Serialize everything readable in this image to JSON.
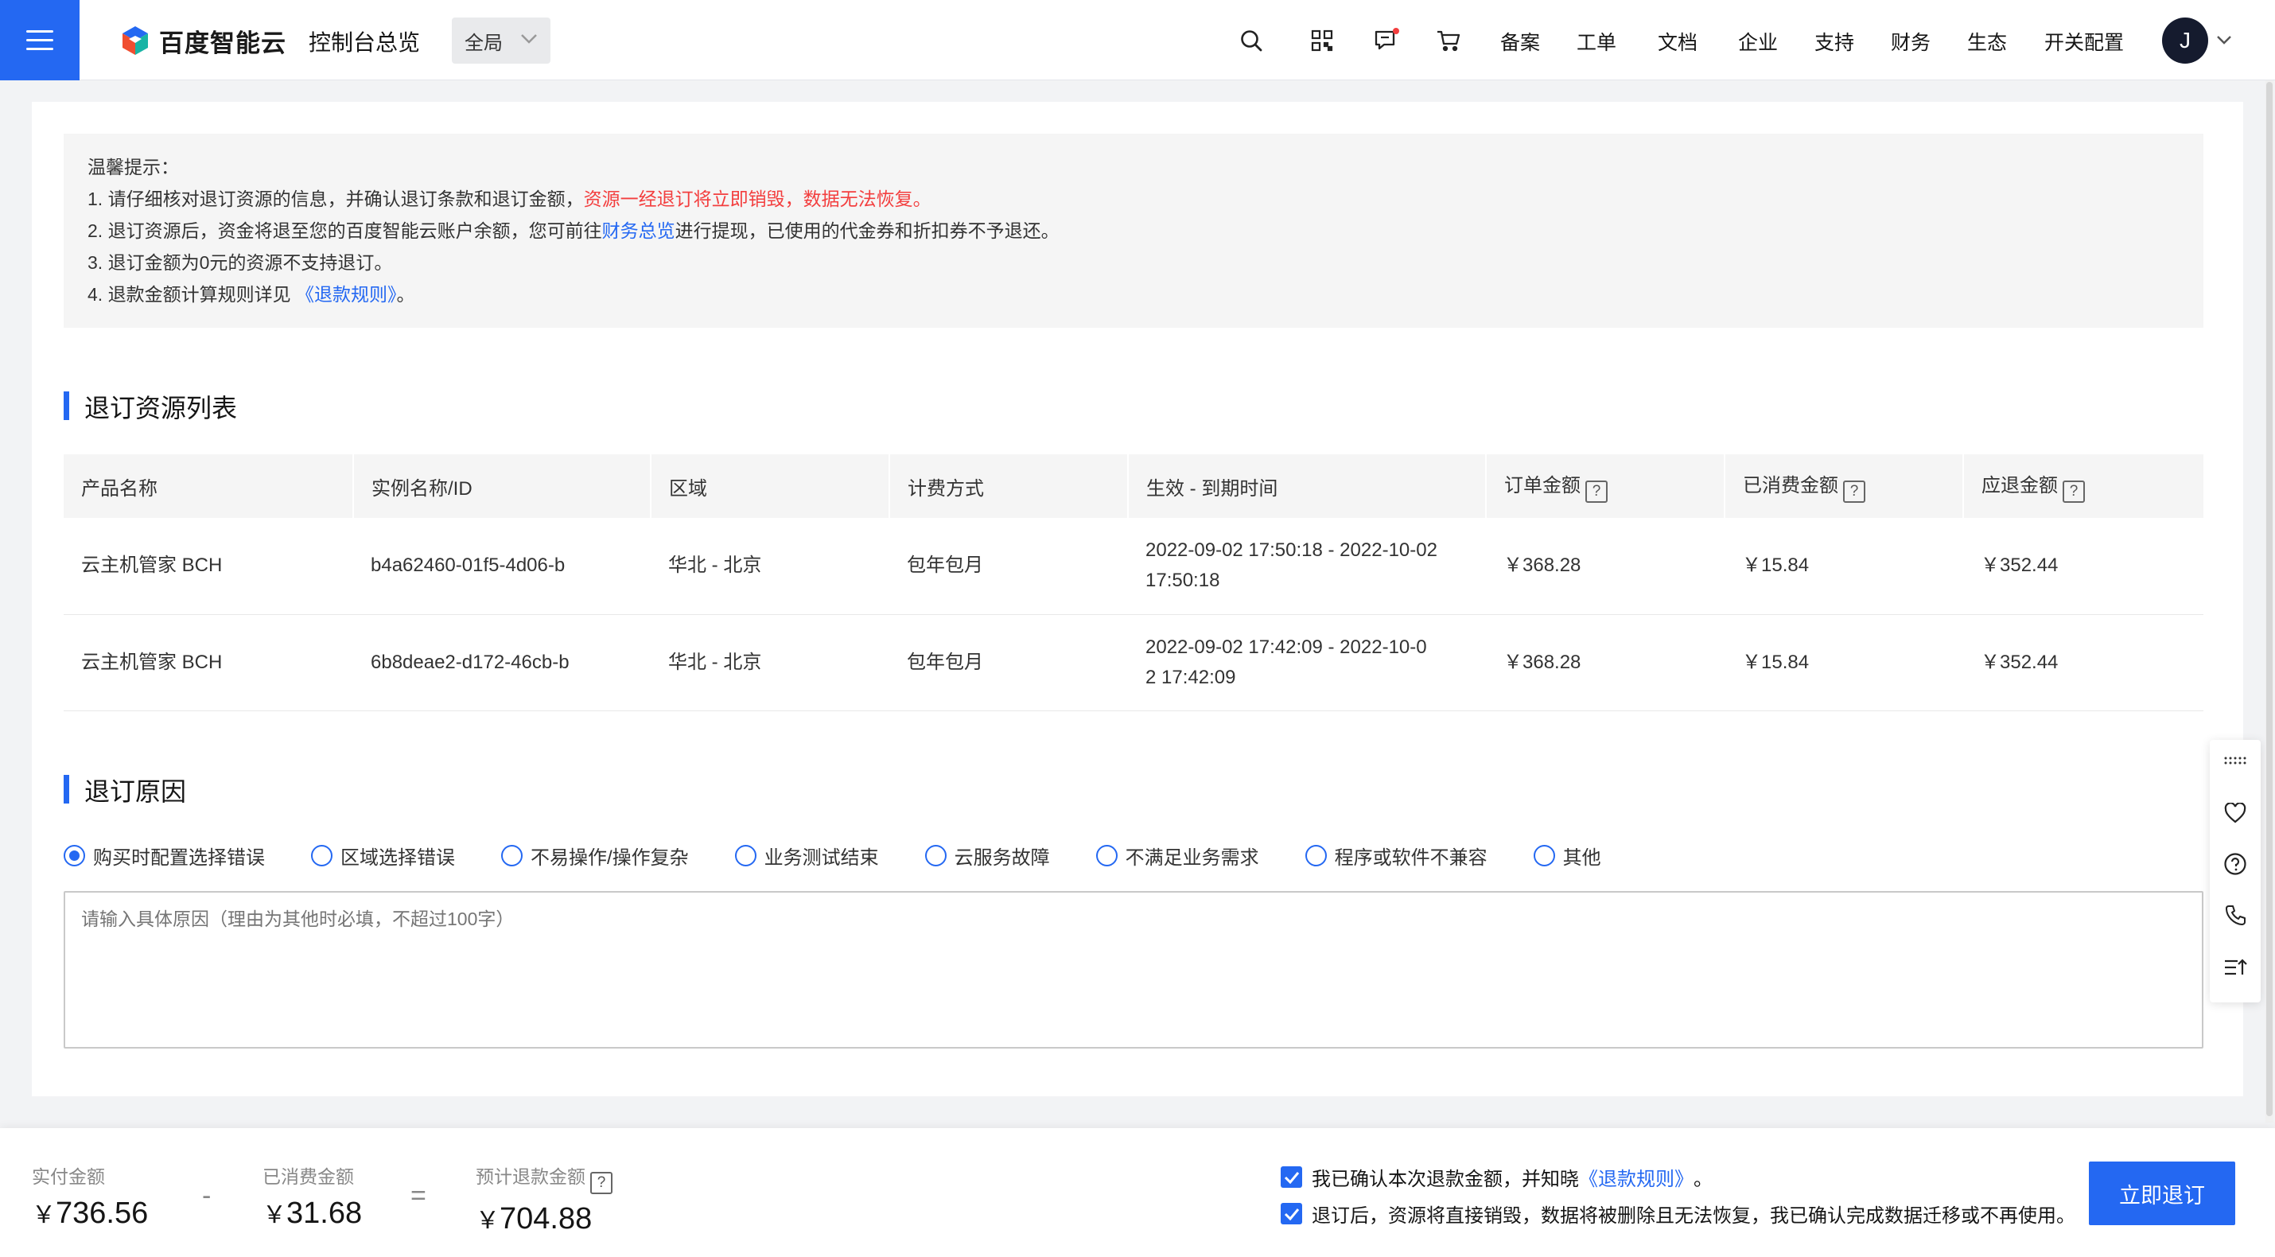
{
  "header": {
    "logo_text": "百度智能云",
    "console_title": "控制台总览",
    "region_value": "全局",
    "nav_links": [
      "备案",
      "工单",
      "文档",
      "企业",
      "支持",
      "财务",
      "生态",
      "开关配置"
    ],
    "avatar_letter": "J",
    "icons": [
      "search-icon",
      "qrcode-icon",
      "message-icon",
      "cart-icon"
    ]
  },
  "notice": {
    "title": "温馨提示：",
    "line1_prefix": "1. 请仔细核对退订资源的信息，并确认退订条款和退订金额，",
    "line1_warning": "资源一经退订将立即销毁，数据无法恢复。",
    "line2_prefix": "2. 退订资源后，资金将退至您的百度智能云账户余额，您可前往",
    "line2_link": "财务总览",
    "line2_suffix": "进行提现，已使用的代金券和折扣券不予退还。",
    "line3": "3. 退订金额为0元的资源不支持退订。",
    "line4_prefix": "4. 退款金额计算规则详见 ",
    "line4_link": "《退款规则》",
    "line4_suffix": "。"
  },
  "resource_section": {
    "title": "退订资源列表",
    "columns": [
      "产品名称",
      "实例名称/ID",
      "区域",
      "计费方式",
      "生效 - 到期时间",
      "订单金额",
      "已消费金额",
      "应退金额"
    ],
    "rows": [
      {
        "product": "云主机管家 BCH",
        "instance": "b4a62460-01f5-4d06-b",
        "region": "华北 - 北京",
        "billing": "包年包月",
        "period_line1": "2022-09-02 17:50:18 - 2022-10-02",
        "period_line2": "17:50:18",
        "order_amount": "￥368.28",
        "consumed": "￥15.84",
        "refund": "￥352.44"
      },
      {
        "product": "云主机管家 BCH",
        "instance": "6b8deae2-d172-46cb-b",
        "region": "华北 - 北京",
        "billing": "包年包月",
        "period_line1": "2022-09-02 17:42:09 - 2022-10-0",
        "period_line2": "2 17:42:09",
        "order_amount": "￥368.28",
        "consumed": "￥15.84",
        "refund": "￥352.44"
      }
    ],
    "help_mark": "?"
  },
  "reason_section": {
    "title": "退订原因",
    "options": [
      "购买时配置选择错误",
      "区域选择错误",
      "不易操作/操作复杂",
      "业务测试结束",
      "云服务故障",
      "不满足业务需求",
      "程序或软件不兼容",
      "其他"
    ],
    "selected_index": 0,
    "textarea_placeholder": "请输入具体原因（理由为其他时必填，不超过100字）"
  },
  "bottom_bar": {
    "paid_label": "实付金额",
    "paid_yen": "￥",
    "paid_value": "736.56",
    "minus": "-",
    "consumed_label": "已消费金额",
    "consumed_yen": "￥",
    "consumed_value": "31.68",
    "equals": "=",
    "estimated_label": "预计退款金额",
    "estimated_yen": "￥",
    "estimated_value": "704.88",
    "confirm1_prefix": "我已确认本次退款金额，并知晓",
    "confirm1_link": "《退款规则》",
    "confirm1_suffix": "。",
    "confirm2": "退订后，资源将直接销毁，数据将被删除且无法恢复，我已确认完成数据迁移或不再使用。",
    "submit_label": "立即退订"
  },
  "colors": {
    "accent": "#2468f2",
    "warning": "#f33e3e",
    "notice_bg": "#f5f5f5"
  }
}
